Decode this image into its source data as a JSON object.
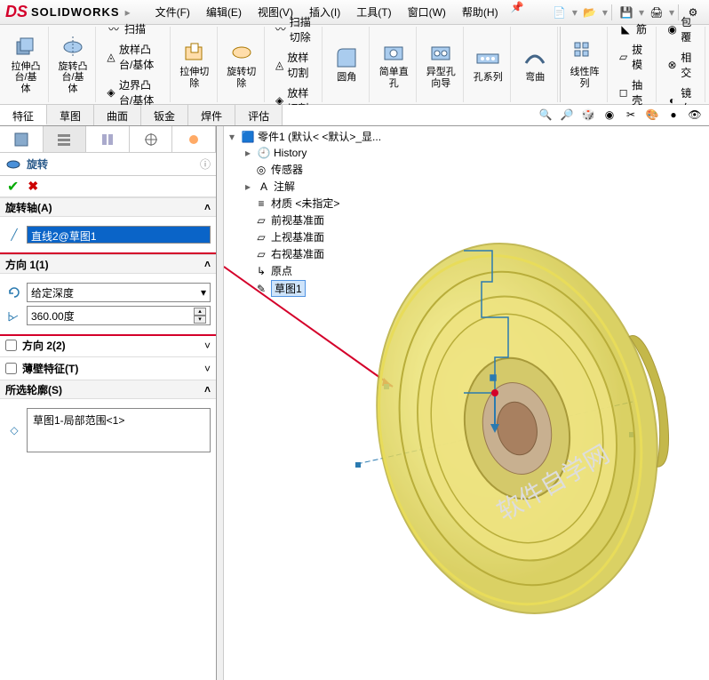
{
  "app": {
    "name": "SOLIDWORKS",
    "logo_prefix": "DS"
  },
  "menu": {
    "file": "文件(F)",
    "edit": "编辑(E)",
    "view": "视图(V)",
    "insert": "插入(I)",
    "tools": "工具(T)",
    "window": "窗口(W)",
    "help": "帮助(H)"
  },
  "ribbon": {
    "extrude_boss": "拉伸凸\n台/基体",
    "revolve_boss": "旋转凸\n台/基体",
    "sweep": "扫描",
    "loft": "放样凸台/基体",
    "boundary": "边界凸台/基体",
    "extrude_cut": "拉伸切\n除",
    "revolve_cut": "旋转切\n除",
    "sweep_cut": "扫描切除",
    "loft_cut": "放样切割",
    "boundary_cut": "放样切割",
    "fillet": "圆角",
    "simple_hole": "简单直\n孔",
    "hole_wizard": "异型孔\n向导",
    "hole_series": "孔系列",
    "bend": "弯曲",
    "lin_pattern": "线性阵\n列",
    "rib": "筋",
    "draft": "拔模",
    "intersect": "相交",
    "wrap": "包覆",
    "shell": "抽壳",
    "mirror": "镜向"
  },
  "tabs": {
    "feature": "特征",
    "sketch": "草图",
    "surface": "曲面",
    "sheetmetal": "钣金",
    "weldment": "焊件",
    "evaluate": "评估"
  },
  "pm": {
    "title": "旋转",
    "axis_hdr": "旋转轴(A)",
    "axis_value": "直线2@草图1",
    "dir1_hdr": "方向 1(1)",
    "depth_type": "给定深度",
    "angle": "360.00度",
    "dir2_hdr": "方向 2(2)",
    "thin_hdr": "薄壁特征(T)",
    "contours_hdr": "所选轮廓(S)",
    "contour1": "草图1-局部范围<1>"
  },
  "tree": {
    "root": "零件1  (默认< <默认>_显...",
    "history": "History",
    "sensors": "传感器",
    "annot": "注解",
    "material": "材质 <未指定>",
    "front": "前视基准面",
    "top": "上视基准面",
    "right": "右视基准面",
    "origin": "原点",
    "sketch1": "草图1"
  },
  "watermark": "软件自学网"
}
